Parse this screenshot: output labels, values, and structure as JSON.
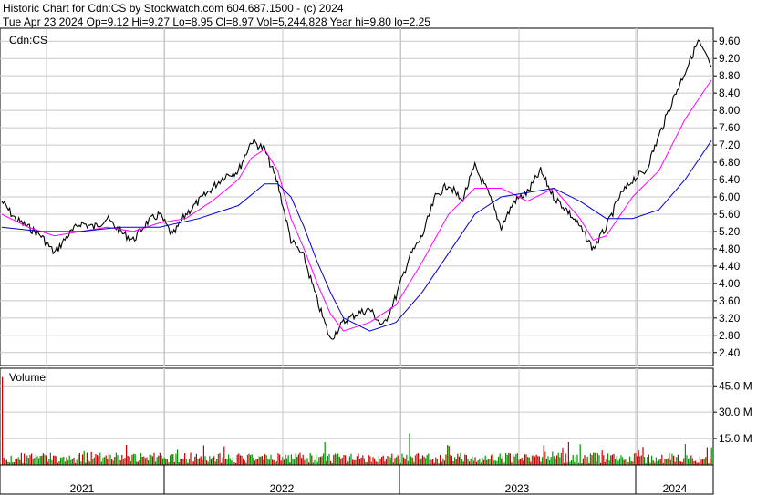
{
  "header": {
    "line1": "Historic Chart for Cdn:CS by Stockwatch.com 604.687.1500 - (c) 2024",
    "line2": "Tue Apr 23 2024  Op=9.12  Hi=9.27  Lo=8.95  Cl=8.97  Vol=5,244,828  Year hi=9.80  lo=2.25"
  },
  "chart_data": [
    {
      "type": "line",
      "panel_label": "Cdn:CS",
      "y_ticks": [
        "9.60",
        "9.20",
        "8.80",
        "8.40",
        "8.00",
        "7.60",
        "7.20",
        "6.80",
        "6.40",
        "6.00",
        "5.60",
        "5.20",
        "4.80",
        "4.40",
        "4.00",
        "3.60",
        "3.20",
        "2.80",
        "2.40"
      ],
      "ylim": [
        2.1,
        9.9
      ],
      "x_year_labels": [
        "2021",
        "2022",
        "2023",
        "2024"
      ],
      "grid": true,
      "series": [
        {
          "color": "#000000",
          "points": [
            [
              "2020-06",
              5.9
            ],
            [
              "2020-07",
              5.5
            ],
            [
              "2020-08",
              5.3
            ],
            [
              "2020-09",
              5.1
            ],
            [
              "2020-10",
              4.7
            ],
            [
              "2020-11",
              5.1
            ],
            [
              "2020-12",
              5.4
            ],
            [
              "2021-01",
              5.3
            ],
            [
              "2021-02",
              5.5
            ],
            [
              "2021-03",
              5.2
            ],
            [
              "2021-04",
              5.0
            ],
            [
              "2021-05",
              5.4
            ],
            [
              "2021-06",
              5.6
            ],
            [
              "2021-07",
              5.1
            ],
            [
              "2021-08",
              5.6
            ],
            [
              "2021-09",
              5.9
            ],
            [
              "2021-10",
              6.2
            ],
            [
              "2021-11",
              6.5
            ],
            [
              "2021-12",
              6.6
            ],
            [
              "2022-01",
              7.3
            ],
            [
              "2022-02",
              7.1
            ],
            [
              "2022-03",
              6.3
            ],
            [
              "2022-04",
              5.0
            ],
            [
              "2022-05",
              4.6
            ],
            [
              "2022-06",
              3.6
            ],
            [
              "2022-07",
              2.7
            ],
            [
              "2022-08",
              3.1
            ],
            [
              "2022-09",
              3.3
            ],
            [
              "2022-10",
              3.4
            ],
            [
              "2022-11",
              3.0
            ],
            [
              "2022-12",
              3.7
            ],
            [
              "2023-01",
              4.6
            ],
            [
              "2023-02",
              5.1
            ],
            [
              "2023-03",
              6.0
            ],
            [
              "2023-04",
              6.3
            ],
            [
              "2023-05",
              5.9
            ],
            [
              "2023-06",
              6.7
            ],
            [
              "2023-07",
              6.1
            ],
            [
              "2023-08",
              5.3
            ],
            [
              "2023-09",
              5.9
            ],
            [
              "2023-10",
              6.1
            ],
            [
              "2023-11",
              6.6
            ],
            [
              "2023-12",
              6.0
            ],
            [
              "2024-01",
              5.7
            ],
            [
              "2024-02",
              5.3
            ],
            [
              "2024-03",
              4.8
            ],
            [
              "2024-04",
              5.3
            ],
            [
              "2024-05",
              6.0
            ],
            [
              "2024-06",
              6.4
            ],
            [
              "2024-07",
              6.6
            ],
            [
              "2024-08",
              7.4
            ],
            [
              "2024-09",
              8.2
            ],
            [
              "2024-10",
              8.9
            ],
            [
              "2024-11",
              9.6
            ],
            [
              "2024-12",
              9.0
            ]
          ]
        },
        {
          "color": "#ff00ff",
          "points": [
            [
              "2020-06",
              5.6
            ],
            [
              "2020-08",
              5.3
            ],
            [
              "2020-10",
              5.1
            ],
            [
              "2020-12",
              5.2
            ],
            [
              "2021-02",
              5.3
            ],
            [
              "2021-04",
              5.2
            ],
            [
              "2021-06",
              5.4
            ],
            [
              "2021-08",
              5.5
            ],
            [
              "2021-10",
              5.9
            ],
            [
              "2021-12",
              6.4
            ],
            [
              "2022-01",
              6.9
            ],
            [
              "2022-02",
              7.1
            ],
            [
              "2022-03",
              6.6
            ],
            [
              "2022-04",
              5.5
            ],
            [
              "2022-05",
              4.8
            ],
            [
              "2022-06",
              4.0
            ],
            [
              "2022-07",
              3.3
            ],
            [
              "2022-08",
              2.9
            ],
            [
              "2022-10",
              3.1
            ],
            [
              "2022-12",
              3.5
            ],
            [
              "2023-02",
              4.5
            ],
            [
              "2023-04",
              5.6
            ],
            [
              "2023-06",
              6.2
            ],
            [
              "2023-08",
              6.2
            ],
            [
              "2023-10",
              5.9
            ],
            [
              "2023-12",
              6.2
            ],
            [
              "2024-02",
              5.5
            ],
            [
              "2024-03",
              5.0
            ],
            [
              "2024-04",
              5.1
            ],
            [
              "2024-06",
              6.0
            ],
            [
              "2024-08",
              6.6
            ],
            [
              "2024-10",
              7.8
            ],
            [
              "2024-12",
              8.7
            ]
          ]
        },
        {
          "color": "#0000cc",
          "points": [
            [
              "2020-06",
              5.3
            ],
            [
              "2020-09",
              5.2
            ],
            [
              "2020-12",
              5.2
            ],
            [
              "2021-03",
              5.3
            ],
            [
              "2021-06",
              5.3
            ],
            [
              "2021-09",
              5.5
            ],
            [
              "2021-12",
              5.8
            ],
            [
              "2022-02",
              6.3
            ],
            [
              "2022-03",
              6.3
            ],
            [
              "2022-04",
              6.0
            ],
            [
              "2022-05",
              5.3
            ],
            [
              "2022-06",
              4.5
            ],
            [
              "2022-07",
              3.8
            ],
            [
              "2022-08",
              3.2
            ],
            [
              "2022-10",
              2.9
            ],
            [
              "2022-12",
              3.1
            ],
            [
              "2023-02",
              3.8
            ],
            [
              "2023-04",
              4.7
            ],
            [
              "2023-06",
              5.6
            ],
            [
              "2023-08",
              6.0
            ],
            [
              "2023-10",
              6.1
            ],
            [
              "2023-12",
              6.2
            ],
            [
              "2024-02",
              5.9
            ],
            [
              "2024-04",
              5.5
            ],
            [
              "2024-06",
              5.5
            ],
            [
              "2024-08",
              5.7
            ],
            [
              "2024-10",
              6.4
            ],
            [
              "2024-12",
              7.3
            ]
          ]
        }
      ]
    },
    {
      "type": "bar",
      "panel_label": "Volume",
      "y_ticks": [
        "45.0 M",
        "30.0 M",
        "15.0 M"
      ],
      "ylim": [
        0,
        55
      ],
      "grid": true,
      "spikes": [
        [
          "2020-06",
          50
        ],
        [
          "2023-01",
          18
        ],
        [
          "2024-12",
          10
        ]
      ]
    }
  ]
}
